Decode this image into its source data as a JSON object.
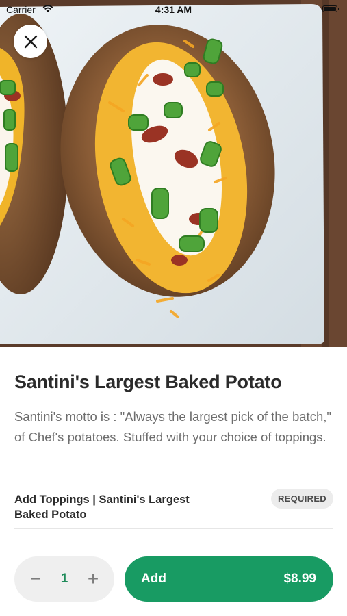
{
  "status_bar": {
    "carrier": "Carrier",
    "time": "4:31 AM",
    "icons": [
      "wifi-icon",
      "battery-icon"
    ]
  },
  "hero": {
    "image_subject": "baked potatoes with cheddar, bacon, sour cream and green onions on a white plate"
  },
  "close": {
    "icon": "close-icon"
  },
  "item": {
    "title": "Santini's Largest Baked Potato",
    "description": "Santini's motto is : \"Always the largest pick of the batch,\" of Chef's potatoes. Stuffed with your choice of toppings."
  },
  "toppings": {
    "title": "Add Toppings | Santini's Largest Baked Potato",
    "badge": "REQUIRED"
  },
  "quantity": {
    "minus": "−",
    "value": "1",
    "plus": "+"
  },
  "add_button": {
    "label": "Add",
    "price": "$8.99"
  },
  "colors": {
    "accent": "#189b63",
    "quantity_text": "#1f8b5a",
    "badge_bg": "#ececec"
  }
}
